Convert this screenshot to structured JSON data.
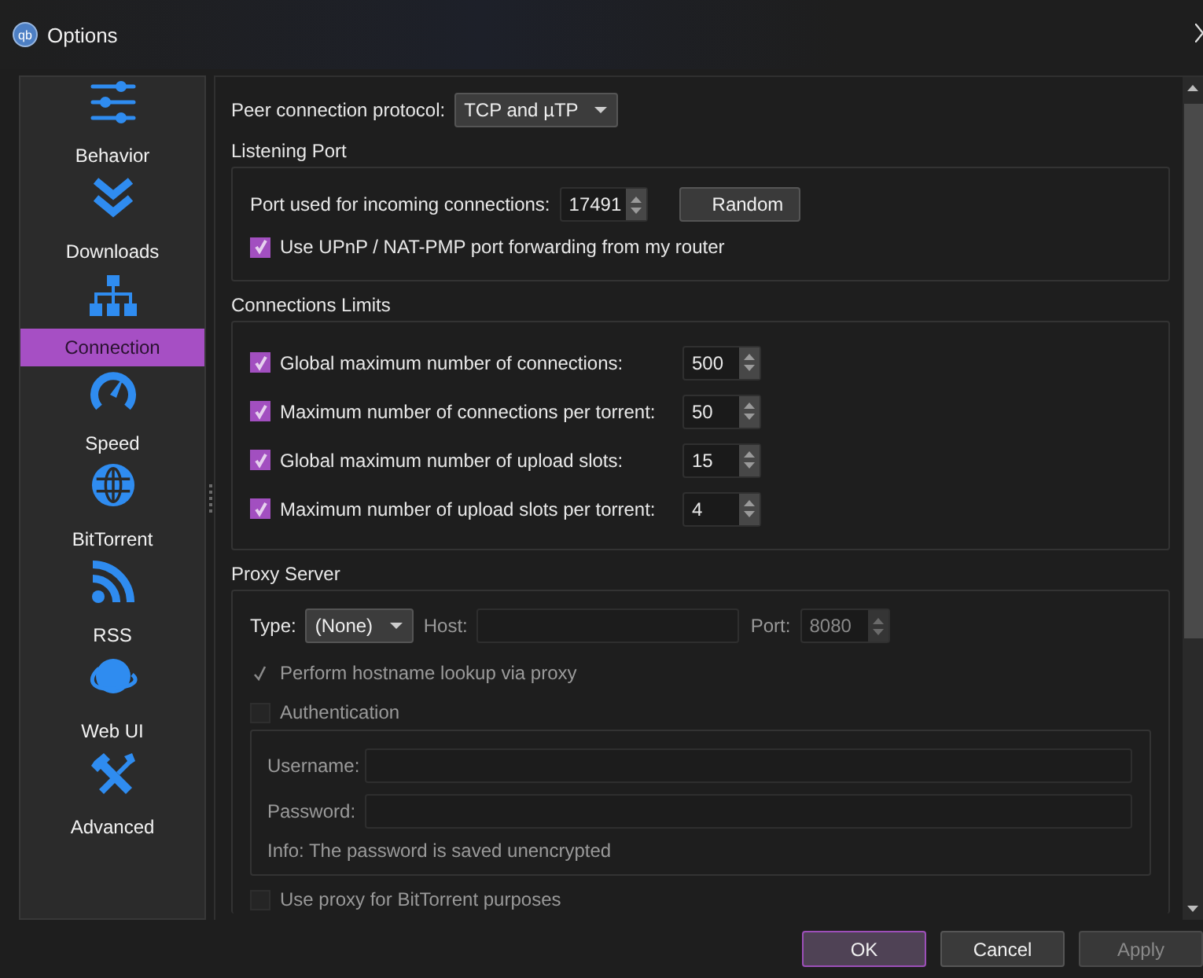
{
  "window": {
    "title": "Options",
    "icon_text": "qb"
  },
  "sidebar": {
    "items": [
      {
        "label": "Behavior",
        "selected": false
      },
      {
        "label": "Downloads",
        "selected": false
      },
      {
        "label": "Connection",
        "selected": true
      },
      {
        "label": "Speed",
        "selected": false
      },
      {
        "label": "BitTorrent",
        "selected": false
      },
      {
        "label": "RSS",
        "selected": false
      },
      {
        "label": "Web UI",
        "selected": false
      },
      {
        "label": "Advanced",
        "selected": false
      }
    ]
  },
  "peer_protocol": {
    "label": "Peer connection protocol:",
    "value": "TCP and µTP"
  },
  "listening_port": {
    "title": "Listening Port",
    "port_label": "Port used for incoming connections:",
    "port_value": "17491",
    "random_button": "Random",
    "upnp": {
      "label": "Use UPnP / NAT-PMP port forwarding from my router",
      "checked": true
    }
  },
  "connection_limits": {
    "title": "Connections Limits",
    "rows": [
      {
        "label": "Global maximum number of connections:",
        "checked": true,
        "value": "500"
      },
      {
        "label": "Maximum number of connections per torrent:",
        "checked": true,
        "value": "50"
      },
      {
        "label": "Global maximum number of upload slots:",
        "checked": true,
        "value": "15"
      },
      {
        "label": "Maximum number of upload slots per torrent:",
        "checked": true,
        "value": "4"
      }
    ]
  },
  "proxy": {
    "title": "Proxy Server",
    "disabled": true,
    "type_label": "Type:",
    "type_value": "(None)",
    "host_label": "Host:",
    "port_label": "Port:",
    "port_value": "8080",
    "hostname_lookup": {
      "label": "Perform hostname lookup via proxy",
      "checked": true
    },
    "authentication": {
      "label": "Authentication",
      "checked": false
    },
    "username_label": "Username:",
    "password_label": "Password:",
    "info": "Info: The password is saved unencrypted",
    "use_for_bittorrent": {
      "label": "Use proxy for BitTorrent purposes",
      "checked": false
    }
  },
  "buttons": [
    {
      "label": "OK",
      "kind": "default",
      "disabled": false
    },
    {
      "label": "Cancel",
      "kind": "normal",
      "disabled": false
    },
    {
      "label": "Apply",
      "kind": "normal",
      "disabled": true
    }
  ]
}
